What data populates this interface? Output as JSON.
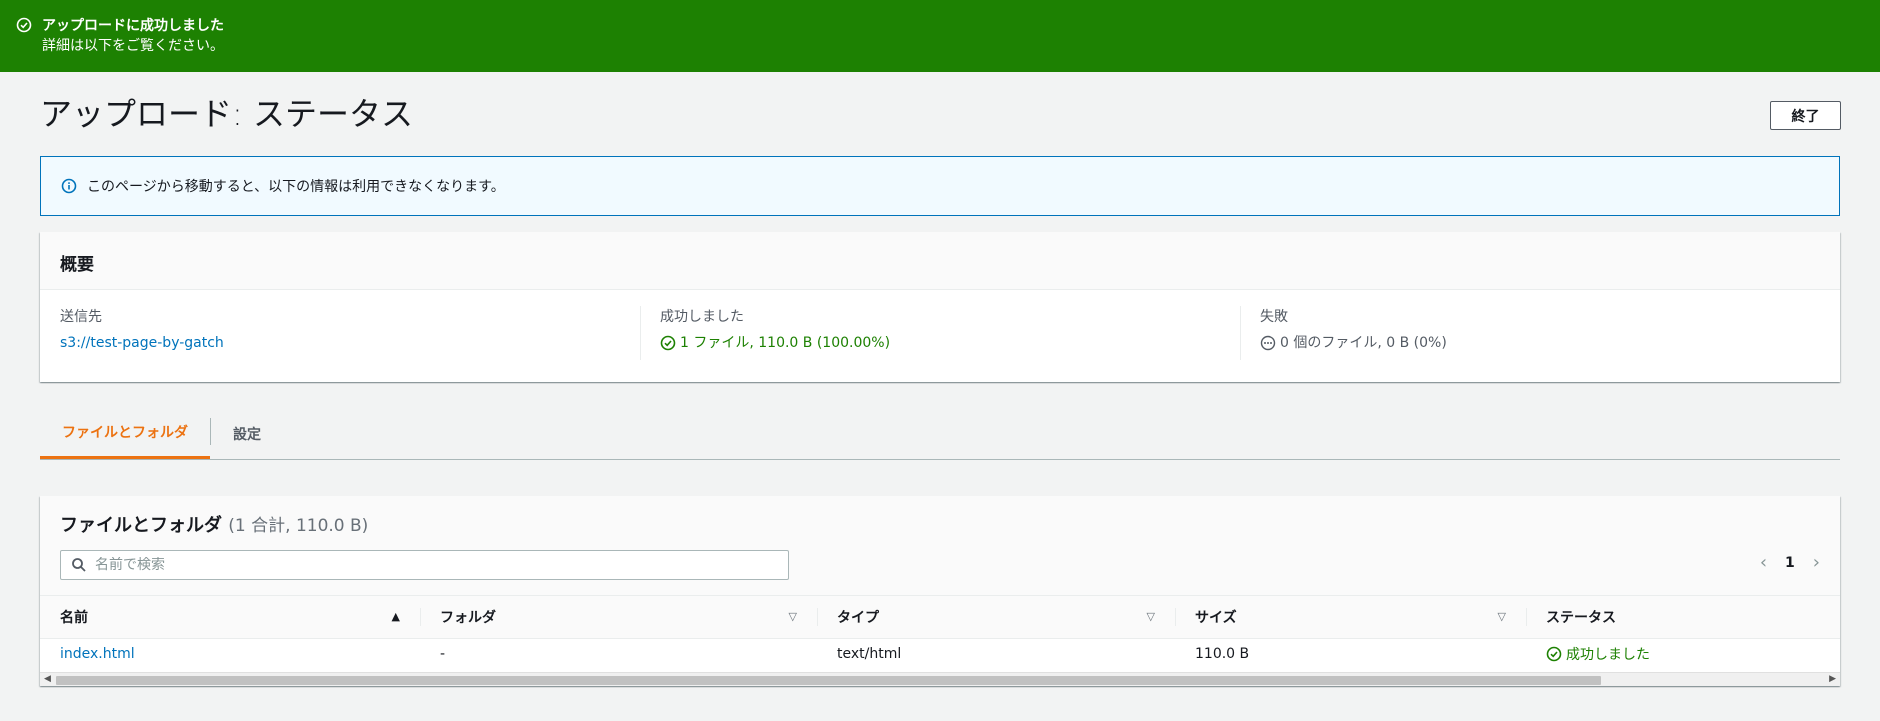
{
  "banner": {
    "title": "アップロードに成功しました",
    "message": "詳細は以下をご覧ください。",
    "color": "#1d8102"
  },
  "header": {
    "title": "アップロード: ステータス",
    "exit_label": "終了"
  },
  "info": {
    "icon": "info-icon",
    "text": "このページから移動すると、以下の情報は利用できなくなります。"
  },
  "summary": {
    "title": "概要",
    "destination_label": "送信先",
    "destination_value": "s3://test-page-by-gatch",
    "success_label": "成功しました",
    "success_value": "1 ファイル, 110.0 B (100.00%)",
    "failed_label": "失敗",
    "failed_value": "0 個のファイル, 0 B (0%)"
  },
  "tabs": [
    {
      "label": "ファイルとフォルダ",
      "active": true
    },
    {
      "label": "設定",
      "active": false
    }
  ],
  "files": {
    "title": "ファイルとフォルダ",
    "count": "(1 合計, 110.0 B)",
    "search_placeholder": "名前で検索",
    "page": "1",
    "columns": [
      "名前",
      "フォルダ",
      "タイプ",
      "サイズ",
      "ステータス"
    ],
    "rows": [
      {
        "name": "index.html",
        "folder": "-",
        "type": "text/html",
        "size": "110.0 B",
        "status": "成功しました"
      }
    ]
  }
}
